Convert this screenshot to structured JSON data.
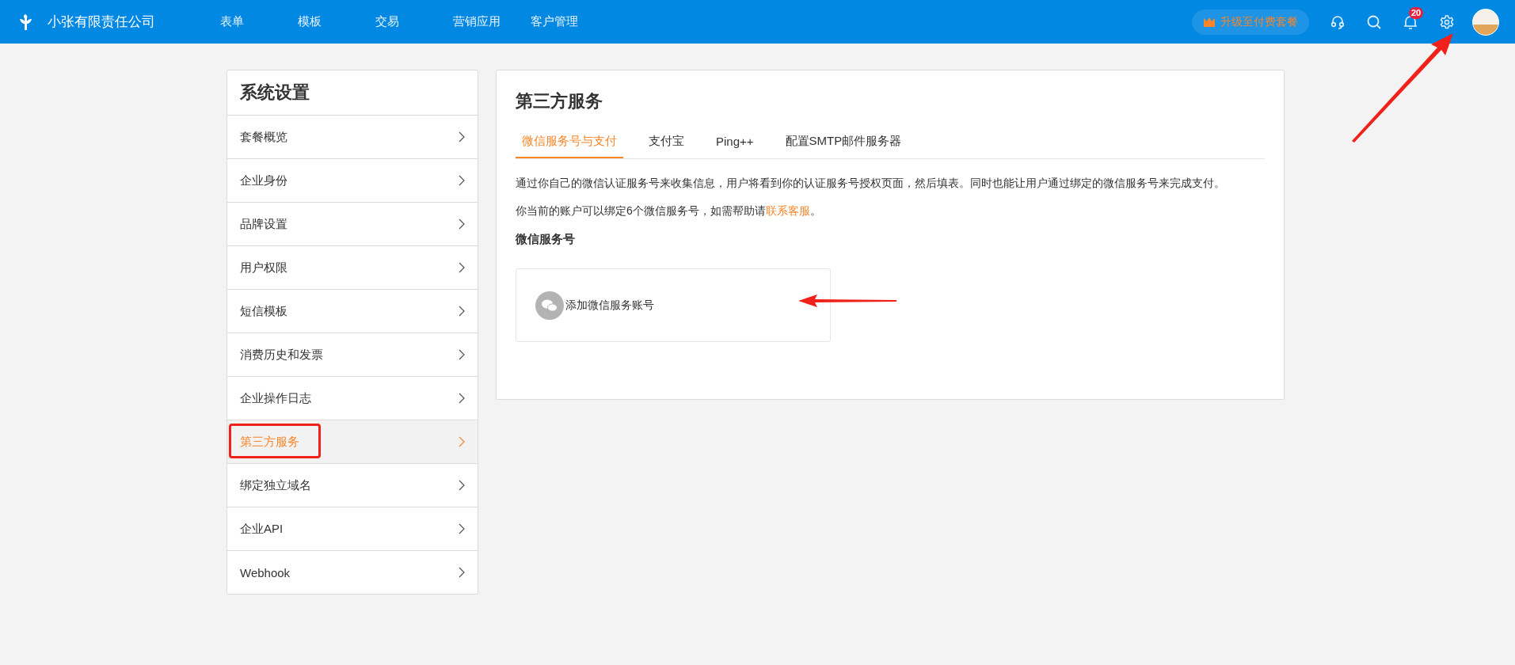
{
  "topbar": {
    "company": "小张有限责任公司",
    "nav": [
      {
        "label": "表单"
      },
      {
        "label": "模板"
      },
      {
        "label": "交易"
      },
      {
        "label": "营销应用"
      },
      {
        "label": "客户管理"
      }
    ],
    "upgrade": "升级至付费套餐",
    "notifications": "20"
  },
  "sidebar": {
    "title": "系统设置",
    "items": [
      {
        "label": "套餐概览",
        "selected": false
      },
      {
        "label": "企业身份",
        "selected": false
      },
      {
        "label": "品牌设置",
        "selected": false
      },
      {
        "label": "用户权限",
        "selected": false
      },
      {
        "label": "短信模板",
        "selected": false
      },
      {
        "label": "消费历史和发票",
        "selected": false
      },
      {
        "label": "企业操作日志",
        "selected": false
      },
      {
        "label": "第三方服务",
        "selected": true
      },
      {
        "label": "绑定独立域名",
        "selected": false
      },
      {
        "label": "企业API",
        "selected": false
      },
      {
        "label": "Webhook",
        "selected": false
      }
    ]
  },
  "main": {
    "title": "第三方服务",
    "tabs": [
      {
        "label": "微信服务号与支付",
        "selected": true
      },
      {
        "label": "支付宝",
        "selected": false
      },
      {
        "label": "Ping++",
        "selected": false
      },
      {
        "label": "配置SMTP邮件服务器",
        "selected": false
      }
    ],
    "description": "通过你自己的微信认证服务号来收集信息，用户将看到你的认证服务号授权页面，然后填表。同时也能让用户通过绑定的微信服务号来完成支付。",
    "limit_text": "你当前的账户可以绑定6个微信服务号，如需帮助请",
    "limit_link": "联系客服",
    "limit_end": "。",
    "section_title": "微信服务号",
    "add_account": "添加微信服务账号"
  }
}
